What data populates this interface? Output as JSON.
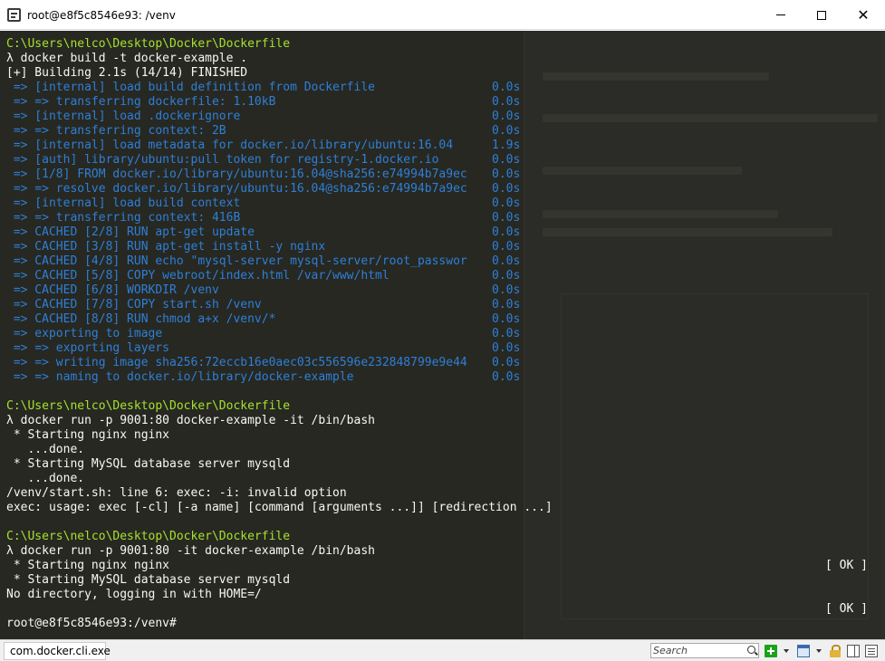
{
  "window": {
    "title": "root@e8f5c8546e93: /venv",
    "icon": "console-app-icon",
    "controls": {
      "minimize": "minimize-icon",
      "maximize": "maximize-icon",
      "close": "✕"
    }
  },
  "terminal": {
    "lines": [
      {
        "text": "C:\\Users\\nelco\\Desktop\\Docker\\Dockerfile",
        "color": "#a6e22e"
      },
      {
        "text": "λ docker build -t docker-example .",
        "color": "#f8f8f2"
      },
      {
        "text": "[+] Building 2.1s (14/14) FINISHED",
        "color": "#f8f8f2"
      },
      {
        "text": " => [internal] load build definition from Dockerfile",
        "time": "0.0s",
        "color": "#2e7fd7"
      },
      {
        "text": " => => transferring dockerfile: 1.10kB",
        "time": "0.0s",
        "color": "#2e7fd7"
      },
      {
        "text": " => [internal] load .dockerignore",
        "time": "0.0s",
        "color": "#2e7fd7"
      },
      {
        "text": " => => transferring context: 2B",
        "time": "0.0s",
        "color": "#2e7fd7"
      },
      {
        "text": " => [internal] load metadata for docker.io/library/ubuntu:16.04",
        "time": "1.9s",
        "color": "#2e7fd7"
      },
      {
        "text": " => [auth] library/ubuntu:pull token for registry-1.docker.io",
        "time": "0.0s",
        "color": "#2e7fd7"
      },
      {
        "text": " => [1/8] FROM docker.io/library/ubuntu:16.04@sha256:e74994b7a9ec",
        "time": "0.0s",
        "color": "#2e7fd7"
      },
      {
        "text": " => => resolve docker.io/library/ubuntu:16.04@sha256:e74994b7a9ec",
        "time": "0.0s",
        "color": "#2e7fd7"
      },
      {
        "text": " => [internal] load build context",
        "time": "0.0s",
        "color": "#2e7fd7"
      },
      {
        "text": " => => transferring context: 416B",
        "time": "0.0s",
        "color": "#2e7fd7"
      },
      {
        "text": " => CACHED [2/8] RUN apt-get update",
        "time": "0.0s",
        "color": "#2e7fd7"
      },
      {
        "text": " => CACHED [3/8] RUN apt-get install -y nginx",
        "time": "0.0s",
        "color": "#2e7fd7"
      },
      {
        "text": " => CACHED [4/8] RUN echo \"mysql-server mysql-server/root_passwor",
        "time": "0.0s",
        "color": "#2e7fd7"
      },
      {
        "text": " => CACHED [5/8] COPY webroot/index.html /var/www/html",
        "time": "0.0s",
        "color": "#2e7fd7"
      },
      {
        "text": " => CACHED [6/8] WORKDIR /venv",
        "time": "0.0s",
        "color": "#2e7fd7"
      },
      {
        "text": " => CACHED [7/8] COPY start.sh /venv",
        "time": "0.0s",
        "color": "#2e7fd7"
      },
      {
        "text": " => CACHED [8/8] RUN chmod a+x /venv/*",
        "time": "0.0s",
        "color": "#2e7fd7"
      },
      {
        "text": " => exporting to image",
        "time": "0.0s",
        "color": "#2e7fd7"
      },
      {
        "text": " => => exporting layers",
        "time": "0.0s",
        "color": "#2e7fd7"
      },
      {
        "text": " => => writing image sha256:72eccb16e0aec03c556596e232848799e9e44",
        "time": "0.0s",
        "color": "#2e7fd7"
      },
      {
        "text": " => => naming to docker.io/library/docker-example",
        "time": "0.0s",
        "color": "#2e7fd7"
      },
      {
        "text": "",
        "color": "#f8f8f2"
      },
      {
        "text": "C:\\Users\\nelco\\Desktop\\Docker\\Dockerfile",
        "color": "#a6e22e"
      },
      {
        "text": "λ docker run -p 9001:80 docker-example -it /bin/bash",
        "color": "#f8f8f2"
      },
      {
        "text": " * Starting nginx nginx",
        "color": "#f8f8f2"
      },
      {
        "text": "   ...done.",
        "color": "#f8f8f2"
      },
      {
        "text": " * Starting MySQL database server mysqld",
        "color": "#f8f8f2"
      },
      {
        "text": "   ...done.",
        "color": "#f8f8f2"
      },
      {
        "text": "/venv/start.sh: line 6: exec: -i: invalid option",
        "color": "#f8f8f2"
      },
      {
        "text": "exec: usage: exec [-cl] [-a name] [command [arguments ...]] [redirection ...]",
        "color": "#f8f8f2"
      },
      {
        "text": "",
        "color": "#f8f8f2"
      },
      {
        "text": "C:\\Users\\nelco\\Desktop\\Docker\\Dockerfile",
        "color": "#a6e22e"
      },
      {
        "text": "λ docker run -p 9001:80 -it docker-example /bin/bash",
        "color": "#f8f8f2"
      },
      {
        "text": " * Starting nginx nginx",
        "ok": "[ OK ]",
        "color": "#f8f8f2"
      },
      {
        "text": " * Starting MySQL database server mysqld",
        "color": "#f8f8f2"
      },
      {
        "text": "No directory, logging in with HOME=/",
        "color": "#f8f8f2"
      },
      {
        "text": "",
        "ok": "[ OK ]",
        "color": "#f8f8f2"
      },
      {
        "text": "root@e8f5c8546e93:/venv#",
        "color": "#f8f8f2"
      }
    ]
  },
  "statusbar": {
    "tab_label": "com.docker.cli.exe",
    "search_placeholder": "Search",
    "icons": [
      "search-icon",
      "new-console-icon",
      "window-icon",
      "lock-icon",
      "panel-icon",
      "list-icon"
    ]
  }
}
